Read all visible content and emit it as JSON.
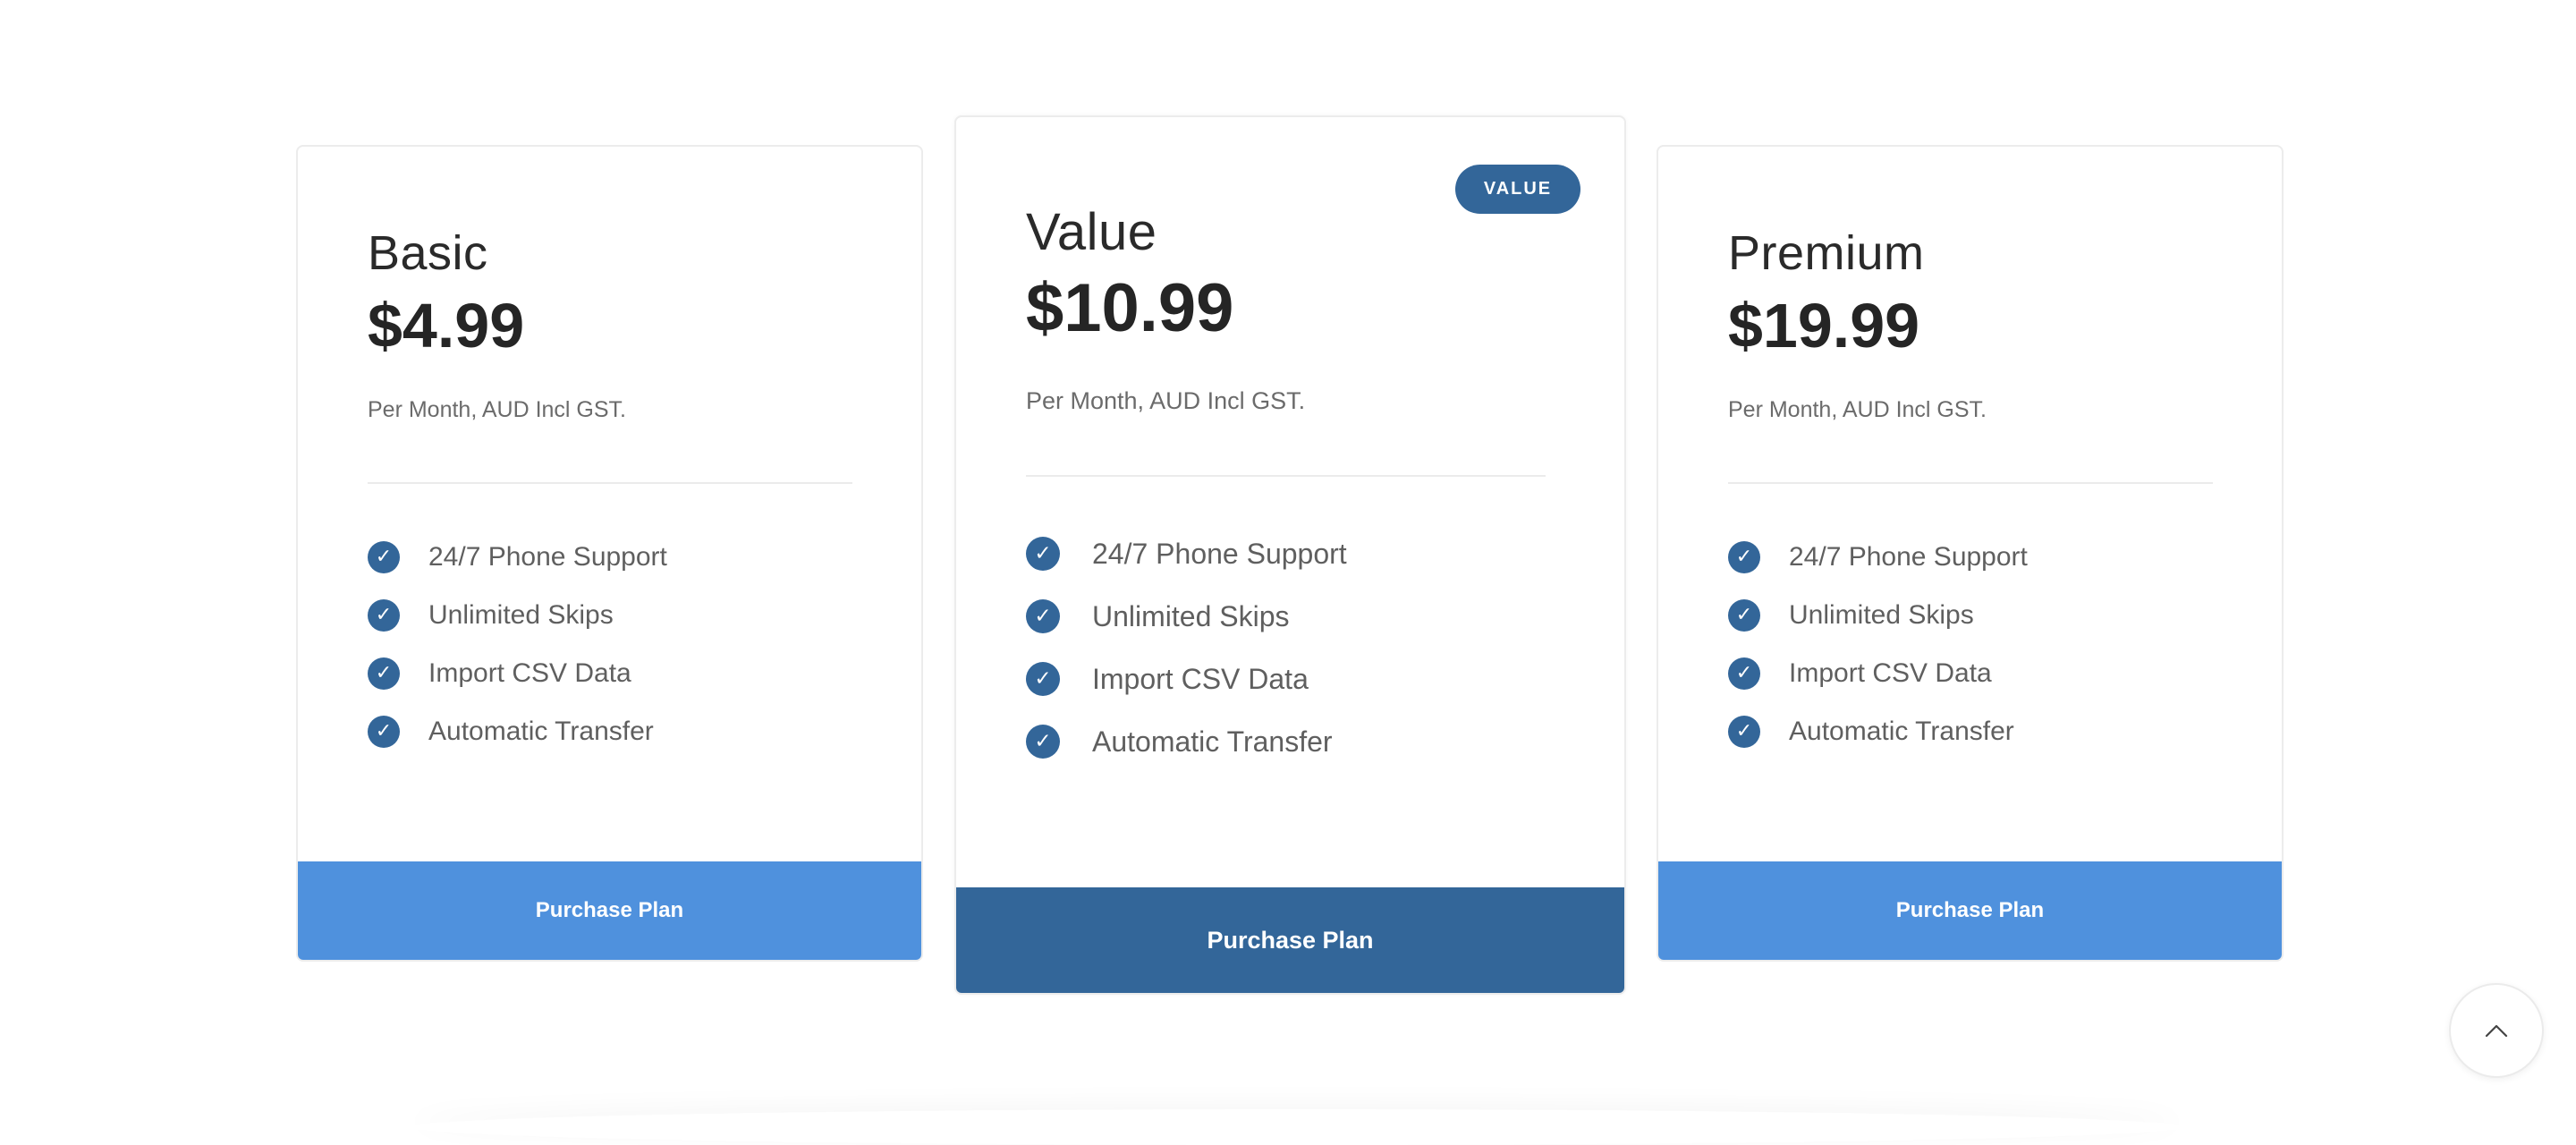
{
  "plans": [
    {
      "name": "Basic",
      "price": "$4.99",
      "period": "Per Month, AUD Incl GST.",
      "features": [
        "24/7 Phone Support",
        "Unlimited Skips",
        "Import CSV Data",
        "Automatic Transfer"
      ],
      "button_label": "Purchase Plan",
      "check_glyph": "✓"
    },
    {
      "name": "Value",
      "badge": "VALUE",
      "price": "$10.99",
      "period": "Per Month, AUD Incl GST.",
      "features": [
        "24/7 Phone Support",
        "Unlimited Skips",
        "Import CSV Data",
        "Automatic Transfer"
      ],
      "button_label": "Purchase Plan",
      "check_glyph": "✓"
    },
    {
      "name": "Premium",
      "price": "$19.99",
      "period": "Per Month, AUD Incl GST.",
      "features": [
        "24/7 Phone Support",
        "Unlimited Skips",
        "Import CSV Data",
        "Automatic Transfer"
      ],
      "button_label": "Purchase Plan",
      "check_glyph": "✓"
    }
  ],
  "scroll_top": {
    "icon": "chevron-up-icon"
  },
  "colors": {
    "primary": "#336699",
    "button_light": "#4f91dd",
    "divider": "#ebebeb",
    "muted_text": "#6b6b6b"
  }
}
